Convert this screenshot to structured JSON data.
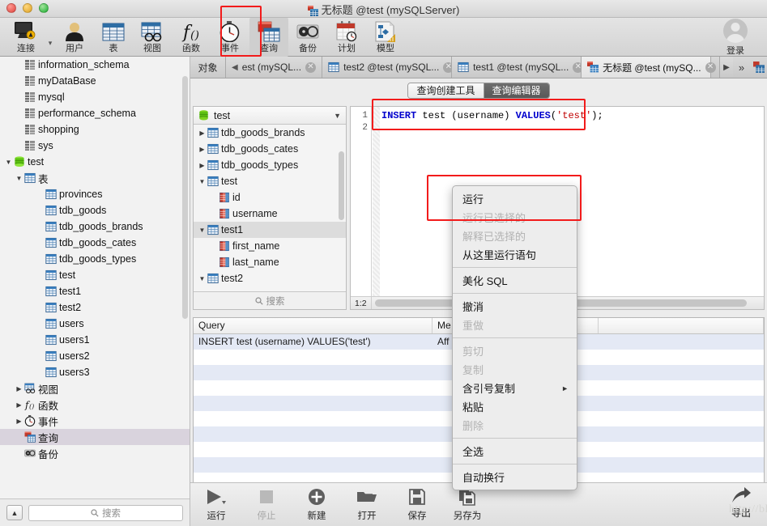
{
  "window": {
    "title": "无标题 @test (mySQLServer)",
    "title_icon": "query-table-icon"
  },
  "toolbar": {
    "items": [
      {
        "label": "连接",
        "icon": "connection-icon",
        "selected": false,
        "has_caret": true
      },
      {
        "label": "用户",
        "icon": "user-icon",
        "selected": false,
        "has_caret": false
      },
      {
        "label": "表",
        "icon": "table-icon",
        "selected": false,
        "has_caret": false
      },
      {
        "label": "视图",
        "icon": "view-icon",
        "selected": false,
        "has_caret": false
      },
      {
        "label": "函数",
        "icon": "function-icon",
        "selected": false,
        "has_caret": false
      },
      {
        "label": "事件",
        "icon": "event-clock-icon",
        "selected": false,
        "has_caret": false
      },
      {
        "label": "查询",
        "icon": "query-icon",
        "selected": true,
        "has_caret": false
      },
      {
        "label": "备份",
        "icon": "backup-icon",
        "selected": false,
        "has_caret": false
      },
      {
        "label": "计划",
        "icon": "schedule-calendar-icon",
        "selected": false,
        "has_caret": false
      },
      {
        "label": "模型",
        "icon": "model-icon",
        "selected": false,
        "has_caret": false
      }
    ],
    "login_label": "登录",
    "login_icon": "avatar-icon"
  },
  "sidebar": {
    "items": [
      {
        "label": "information_schema",
        "indent": 1,
        "disc": "",
        "icon": "database-icon",
        "selected": false
      },
      {
        "label": "myDataBase",
        "indent": 1,
        "disc": "",
        "icon": "database-icon",
        "selected": false
      },
      {
        "label": "mysql",
        "indent": 1,
        "disc": "",
        "icon": "database-icon",
        "selected": false
      },
      {
        "label": "performance_schema",
        "indent": 1,
        "disc": "",
        "icon": "database-icon",
        "selected": false
      },
      {
        "label": "shopping",
        "indent": 1,
        "disc": "",
        "icon": "database-icon",
        "selected": false
      },
      {
        "label": "sys",
        "indent": 1,
        "disc": "",
        "icon": "database-icon",
        "selected": false
      },
      {
        "label": "test",
        "indent": 0,
        "disc": "▼",
        "icon": "database-open-icon",
        "selected": false
      },
      {
        "label": "表",
        "indent": 1,
        "disc": "▼",
        "icon": "table-icon",
        "selected": false
      },
      {
        "label": "provinces",
        "indent": 3,
        "disc": "",
        "icon": "table-icon",
        "selected": false
      },
      {
        "label": "tdb_goods",
        "indent": 3,
        "disc": "",
        "icon": "table-icon",
        "selected": false
      },
      {
        "label": "tdb_goods_brands",
        "indent": 3,
        "disc": "",
        "icon": "table-icon",
        "selected": false
      },
      {
        "label": "tdb_goods_cates",
        "indent": 3,
        "disc": "",
        "icon": "table-icon",
        "selected": false
      },
      {
        "label": "tdb_goods_types",
        "indent": 3,
        "disc": "",
        "icon": "table-icon",
        "selected": false
      },
      {
        "label": "test",
        "indent": 3,
        "disc": "",
        "icon": "table-icon",
        "selected": false
      },
      {
        "label": "test1",
        "indent": 3,
        "disc": "",
        "icon": "table-icon",
        "selected": false
      },
      {
        "label": "test2",
        "indent": 3,
        "disc": "",
        "icon": "table-icon",
        "selected": false
      },
      {
        "label": "users",
        "indent": 3,
        "disc": "",
        "icon": "table-icon",
        "selected": false
      },
      {
        "label": "users1",
        "indent": 3,
        "disc": "",
        "icon": "table-icon",
        "selected": false
      },
      {
        "label": "users2",
        "indent": 3,
        "disc": "",
        "icon": "table-icon",
        "selected": false
      },
      {
        "label": "users3",
        "indent": 3,
        "disc": "",
        "icon": "table-icon",
        "selected": false
      },
      {
        "label": "视图",
        "indent": 1,
        "disc": "▶",
        "icon": "view-icon",
        "selected": false
      },
      {
        "label": "函数",
        "indent": 1,
        "disc": "▶",
        "icon": "function-icon",
        "selected": false
      },
      {
        "label": "事件",
        "indent": 1,
        "disc": "▶",
        "icon": "event-clock-icon",
        "selected": false
      },
      {
        "label": "查询",
        "indent": 1,
        "disc": "",
        "icon": "query-icon",
        "selected": true
      },
      {
        "label": "备份",
        "indent": 1,
        "disc": "",
        "icon": "backup-icon",
        "selected": false
      }
    ],
    "search_placeholder": "搜索",
    "collapse_icon": "collapse-up-icon",
    "search_icon": "search-icon"
  },
  "tabbar": {
    "object_label": "对象",
    "tabs": [
      {
        "label": "est (mySQL...",
        "active": false,
        "icon": "left-arrow-icon",
        "truncated_left": true
      },
      {
        "label": "test2 @test (mySQL...",
        "active": false,
        "icon": "table-icon",
        "truncated_left": false
      },
      {
        "label": "test1 @test (mySQL...",
        "active": false,
        "icon": "table-icon",
        "truncated_left": false
      },
      {
        "label": "无标题 @test (mySQ...",
        "active": true,
        "icon": "query-table-icon",
        "truncated_left": false
      }
    ],
    "next_icon": "right-arrow-icon",
    "overflow_icon": "double-chevron-icon",
    "end_icon": "query-table-icon"
  },
  "subtabs": {
    "items": [
      {
        "label": "查询创建工具",
        "active": false
      },
      {
        "label": "查询编辑器",
        "active": true
      }
    ]
  },
  "db_panel": {
    "selected_db": "test",
    "db_icon": "database-open-icon",
    "caret_icon": "chevron-down-icon",
    "tree": [
      {
        "label": "tdb_goods_brands",
        "indent": 0,
        "disc": "▶",
        "icon": "table-icon",
        "selected": false
      },
      {
        "label": "tdb_goods_cates",
        "indent": 0,
        "disc": "▶",
        "icon": "table-icon",
        "selected": false
      },
      {
        "label": "tdb_goods_types",
        "indent": 0,
        "disc": "▶",
        "icon": "table-icon",
        "selected": false
      },
      {
        "label": "test",
        "indent": 0,
        "disc": "▼",
        "icon": "table-icon",
        "selected": false
      },
      {
        "label": "id",
        "indent": 1,
        "disc": "",
        "icon": "column-icon",
        "selected": false
      },
      {
        "label": "username",
        "indent": 1,
        "disc": "",
        "icon": "column-icon",
        "selected": false
      },
      {
        "label": "test1",
        "indent": 0,
        "disc": "▼",
        "icon": "table-icon",
        "selected": true
      },
      {
        "label": "first_name",
        "indent": 1,
        "disc": "",
        "icon": "column-icon",
        "selected": false
      },
      {
        "label": "last_name",
        "indent": 1,
        "disc": "",
        "icon": "column-icon",
        "selected": false
      },
      {
        "label": "test2",
        "indent": 0,
        "disc": "▼",
        "icon": "table-icon",
        "selected": false
      }
    ],
    "search_placeholder": "搜索",
    "search_icon": "search-icon"
  },
  "editor": {
    "line_numbers": [
      "1",
      "2"
    ],
    "sql_keyword1": "INSERT",
    "sql_mid": " test (username) ",
    "sql_keyword2": "VALUES",
    "sql_open": "(",
    "sql_string": "'test'",
    "sql_close": ");",
    "full_sql": "INSERT test (username) VALUES('test');",
    "cursor_position": "1:2"
  },
  "results": {
    "columns": [
      "Query",
      "Me"
    ],
    "rows": [
      {
        "query": "INSERT test (username) VALUES('test')",
        "message": "Aff"
      },
      {
        "query": "",
        "message": ""
      },
      {
        "query": "",
        "message": ""
      },
      {
        "query": "",
        "message": ""
      },
      {
        "query": "",
        "message": ""
      },
      {
        "query": "",
        "message": ""
      },
      {
        "query": "",
        "message": ""
      },
      {
        "query": "",
        "message": ""
      },
      {
        "query": "",
        "message": ""
      },
      {
        "query": "",
        "message": ""
      },
      {
        "query": "",
        "message": ""
      },
      {
        "query": "",
        "message": ""
      }
    ]
  },
  "bottom_toolbar": {
    "buttons": [
      {
        "label": "运行",
        "icon": "play-icon",
        "disabled": false,
        "has_caret": true
      },
      {
        "label": "停止",
        "icon": "stop-icon",
        "disabled": true,
        "has_caret": false
      },
      {
        "label": "新建",
        "icon": "plus-icon",
        "disabled": false,
        "has_caret": false
      },
      {
        "label": "打开",
        "icon": "folder-icon",
        "disabled": false,
        "has_caret": false
      },
      {
        "label": "保存",
        "icon": "save-icon",
        "disabled": false,
        "has_caret": false
      },
      {
        "label": "另存为",
        "icon": "save-as-icon",
        "disabled": false,
        "has_caret": false
      }
    ],
    "export": {
      "label": "导出",
      "icon": "export-arrow-icon"
    }
  },
  "context_menu": {
    "items": [
      {
        "label": "运行",
        "disabled": false,
        "submenu": false,
        "sep_after": false
      },
      {
        "label": "运行已选择的",
        "disabled": true,
        "submenu": false,
        "sep_after": false
      },
      {
        "label": "解释已选择的",
        "disabled": true,
        "submenu": false,
        "sep_after": false
      },
      {
        "label": "从这里运行语句",
        "disabled": false,
        "submenu": false,
        "sep_after": true
      },
      {
        "label": "美化 SQL",
        "disabled": false,
        "submenu": false,
        "sep_after": true
      },
      {
        "label": "撤消",
        "disabled": false,
        "submenu": false,
        "sep_after": false
      },
      {
        "label": "重做",
        "disabled": true,
        "submenu": false,
        "sep_after": true
      },
      {
        "label": "剪切",
        "disabled": true,
        "submenu": false,
        "sep_after": false
      },
      {
        "label": "复制",
        "disabled": true,
        "submenu": false,
        "sep_after": false
      },
      {
        "label": "含引号复制",
        "disabled": false,
        "submenu": true,
        "sep_after": false
      },
      {
        "label": "粘贴",
        "disabled": false,
        "submenu": false,
        "sep_after": false
      },
      {
        "label": "删除",
        "disabled": true,
        "submenu": false,
        "sep_after": true
      },
      {
        "label": "全选",
        "disabled": false,
        "submenu": false,
        "sep_after": true
      },
      {
        "label": "自动换行",
        "disabled": false,
        "submenu": false,
        "sep_after": false
      }
    ],
    "submenu_arrow": "►"
  },
  "annotations": {
    "boxes": [
      "query-toolbar-highlight",
      "sql-statement-highlight",
      "run-menu-item-highlight"
    ],
    "color": "#f21b1b"
  },
  "watermark": {
    "text": "http://blog.csdn.net/wtda"
  }
}
